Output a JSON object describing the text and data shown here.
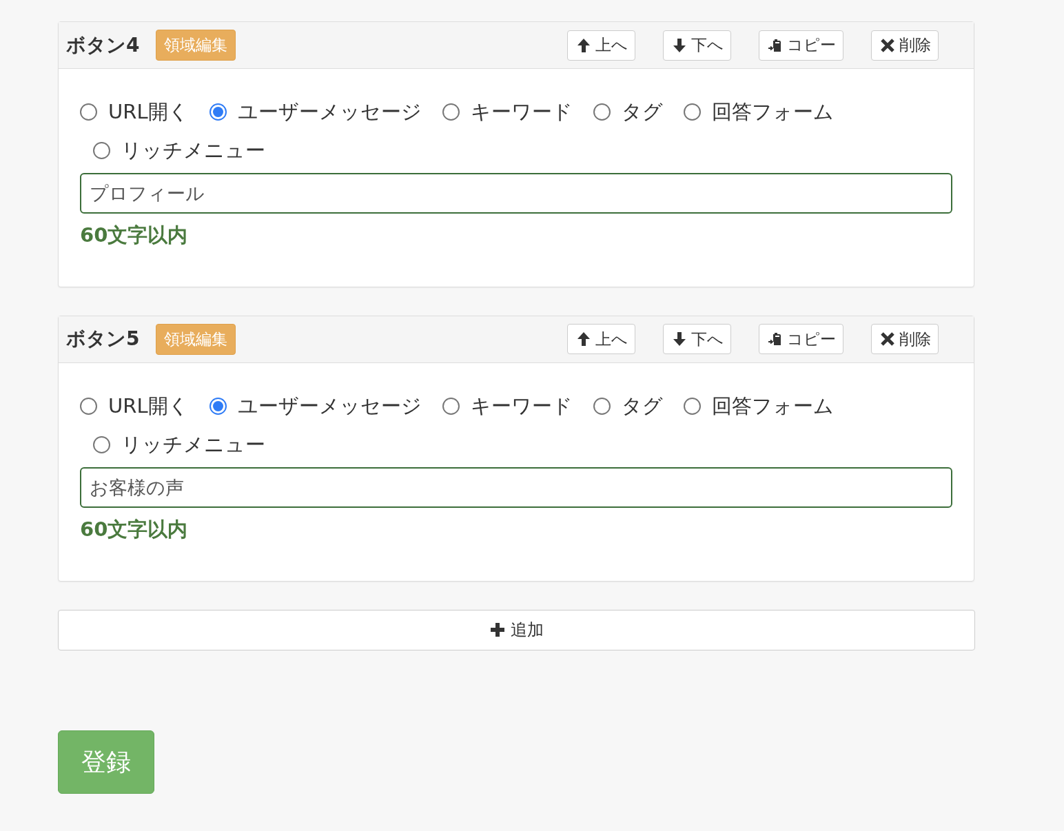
{
  "panels": [
    {
      "title": "ボタン4",
      "badge": "領域編集",
      "actions": [
        {
          "kind": "up",
          "label": "上へ"
        },
        {
          "kind": "down",
          "label": "下へ"
        },
        {
          "kind": "copy",
          "label": "コピー"
        },
        {
          "kind": "delete",
          "label": "削除"
        }
      ],
      "options": [
        {
          "label": "URL開く",
          "selected": false
        },
        {
          "label": "ユーザーメッセージ",
          "selected": true
        },
        {
          "label": "キーワード",
          "selected": false
        },
        {
          "label": "タグ",
          "selected": false
        },
        {
          "label": "回答フォーム",
          "selected": false
        },
        {
          "label": "リッチメニュー",
          "selected": false
        }
      ],
      "field": {
        "value": "プロフィール"
      },
      "hint": "60文字以内"
    },
    {
      "title": "ボタン5",
      "badge": "領域編集",
      "actions": [
        {
          "kind": "up",
          "label": "上へ"
        },
        {
          "kind": "down",
          "label": "下へ"
        },
        {
          "kind": "copy",
          "label": "コピー"
        },
        {
          "kind": "delete",
          "label": "削除"
        }
      ],
      "options": [
        {
          "label": "URL開く",
          "selected": false
        },
        {
          "label": "ユーザーメッセージ",
          "selected": true
        },
        {
          "label": "キーワード",
          "selected": false
        },
        {
          "label": "タグ",
          "selected": false
        },
        {
          "label": "回答フォーム",
          "selected": false
        },
        {
          "label": "リッチメニュー",
          "selected": false
        }
      ],
      "field": {
        "value": "お客様の声"
      },
      "hint": "60文字以内"
    }
  ],
  "add_button": {
    "label": "追加"
  },
  "submit_button": {
    "label": "登録"
  }
}
